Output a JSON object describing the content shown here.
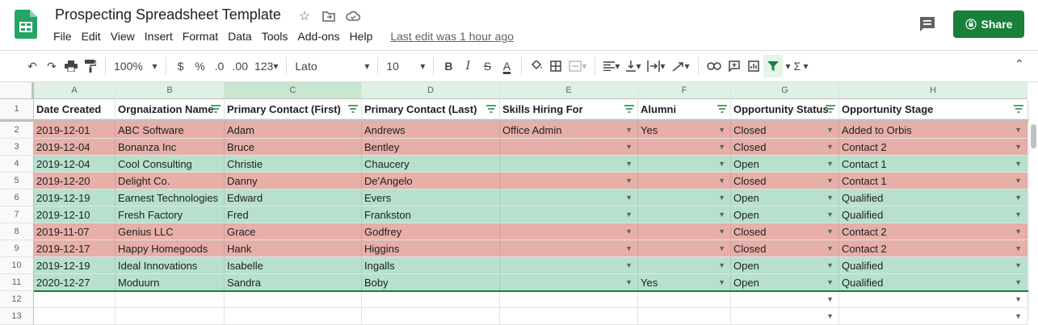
{
  "app": {
    "title": "Prospecting Spreadsheet Template",
    "menu": [
      "File",
      "Edit",
      "View",
      "Insert",
      "Format",
      "Data",
      "Tools",
      "Add-ons",
      "Help"
    ],
    "last_edit": "Last edit was 1 hour ago",
    "share_label": "Share",
    "brand_color": "#188038"
  },
  "toolbar": {
    "zoom": "100%",
    "currency": "$",
    "percent": "%",
    "decrease_decimal": ".0",
    "increase_decimal": ".00",
    "more_formats": "123",
    "font": "Lato",
    "font_size": "10",
    "bold": "B",
    "italic": "I",
    "strike": "S",
    "text_color": "A"
  },
  "columns": [
    "A",
    "B",
    "C",
    "D",
    "E",
    "F",
    "G",
    "H"
  ],
  "headers": [
    "Date Created",
    "Orgnaization Name",
    "Primary Contact (First)",
    "Primary Contact (Last)",
    "Skills Hiring For",
    "Alumni",
    "Opportunity Status",
    "Opportunity Stage"
  ],
  "rows": [
    {
      "num": "2",
      "color": "red",
      "cells": [
        "2019-12-01",
        "ABC Software",
        "Adam",
        "Andrews",
        "Office Admin",
        "Yes",
        "Closed",
        "Added to Orbis"
      ]
    },
    {
      "num": "3",
      "color": "red",
      "cells": [
        "2019-12-04",
        "Bonanza Inc",
        "Bruce",
        "Bentley",
        "",
        "",
        "Closed",
        "Contact 2"
      ]
    },
    {
      "num": "4",
      "color": "green",
      "cells": [
        "2019-12-04",
        "Cool Consulting",
        "Christie",
        "Chaucery",
        "",
        "",
        "Open",
        "Contact 1"
      ]
    },
    {
      "num": "5",
      "color": "red",
      "cells": [
        "2019-12-20",
        "Delight Co.",
        "Danny",
        "De'Angelo",
        "",
        "",
        "Closed",
        "Contact 1"
      ]
    },
    {
      "num": "6",
      "color": "green",
      "cells": [
        "2019-12-19",
        "Earnest Technologies",
        "Edward",
        "Evers",
        "",
        "",
        "Open",
        "Qualified"
      ]
    },
    {
      "num": "7",
      "color": "green",
      "cells": [
        "2019-12-10",
        "Fresh Factory",
        "Fred",
        "Frankston",
        "",
        "",
        "Open",
        "Qualified"
      ]
    },
    {
      "num": "8",
      "color": "red",
      "cells": [
        "2019-11-07",
        "Genius LLC",
        "Grace",
        "Godfrey",
        "",
        "",
        "Closed",
        "Contact 2"
      ]
    },
    {
      "num": "9",
      "color": "red",
      "cells": [
        "2019-12-17",
        "Happy Homegoods",
        "Hank",
        "Higgins",
        "",
        "",
        "Closed",
        "Contact 2"
      ]
    },
    {
      "num": "10",
      "color": "green",
      "cells": [
        "2019-12-19",
        "Ideal Innovations",
        "Isabelle",
        "Ingalls",
        "",
        "",
        "Open",
        "Qualified"
      ]
    },
    {
      "num": "11",
      "color": "green",
      "cells": [
        "2020-12-27",
        "Moduurn",
        "Sandra",
        "Boby",
        "",
        "Yes",
        "Open",
        "Qualified"
      ]
    },
    {
      "num": "12",
      "color": "white",
      "cells": [
        "",
        "",
        "",
        "",
        "",
        "",
        "",
        ""
      ]
    },
    {
      "num": "13",
      "color": "white",
      "cells": [
        "",
        "",
        "",
        "",
        "",
        "",
        "",
        ""
      ]
    }
  ],
  "header_row_num": "1",
  "colors": {
    "closed_row": "#e6afa8",
    "open_row": "#b7e1cd",
    "filter_green": "#188038"
  }
}
